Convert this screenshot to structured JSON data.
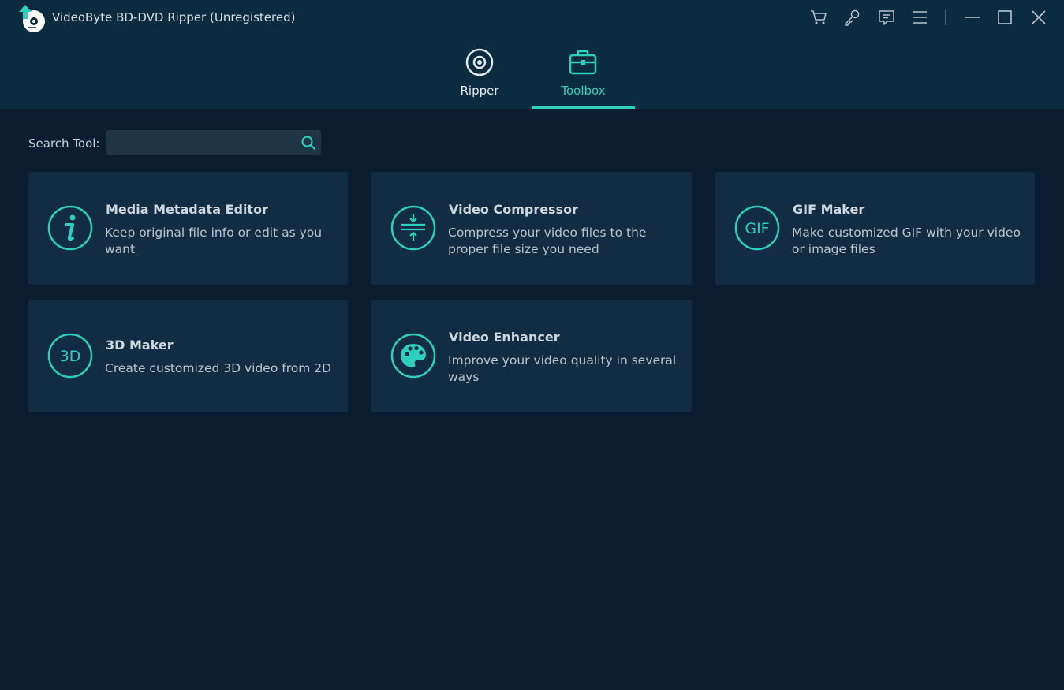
{
  "app": {
    "title": "VideoByte BD-DVD Ripper (Unregistered)",
    "logo_icon": "videobyte-logo-icon",
    "accent_color": "#2fcfbd"
  },
  "titlebar": {
    "buttons": [
      "cart-icon",
      "key-icon",
      "feedback-icon",
      "menu-icon",
      "minimize-icon",
      "maximize-icon",
      "close-icon"
    ]
  },
  "tabs": [
    {
      "label": "Ripper",
      "icon": "disc-icon",
      "active": false
    },
    {
      "label": "Toolbox",
      "icon": "toolbox-icon",
      "active": true
    }
  ],
  "search": {
    "label": "Search Tool:",
    "value": "",
    "placeholder": ""
  },
  "tools": [
    {
      "title": "Media Metadata Editor",
      "desc": "Keep original file info or edit as you want",
      "icon": "info-icon"
    },
    {
      "title": "Video Compressor",
      "desc": "Compress your video files to the proper file size you need",
      "icon": "compress-icon"
    },
    {
      "title": "GIF Maker",
      "desc": "Make customized GIF with your video or image files",
      "icon": "gif-icon",
      "icon_text": "GIF"
    },
    {
      "title": "3D Maker",
      "desc": "Create customized 3D video from 2D",
      "icon": "3d-icon",
      "icon_text": "3D"
    },
    {
      "title": "Video Enhancer",
      "desc": "Improve your video quality in several ways",
      "icon": "palette-icon"
    }
  ]
}
